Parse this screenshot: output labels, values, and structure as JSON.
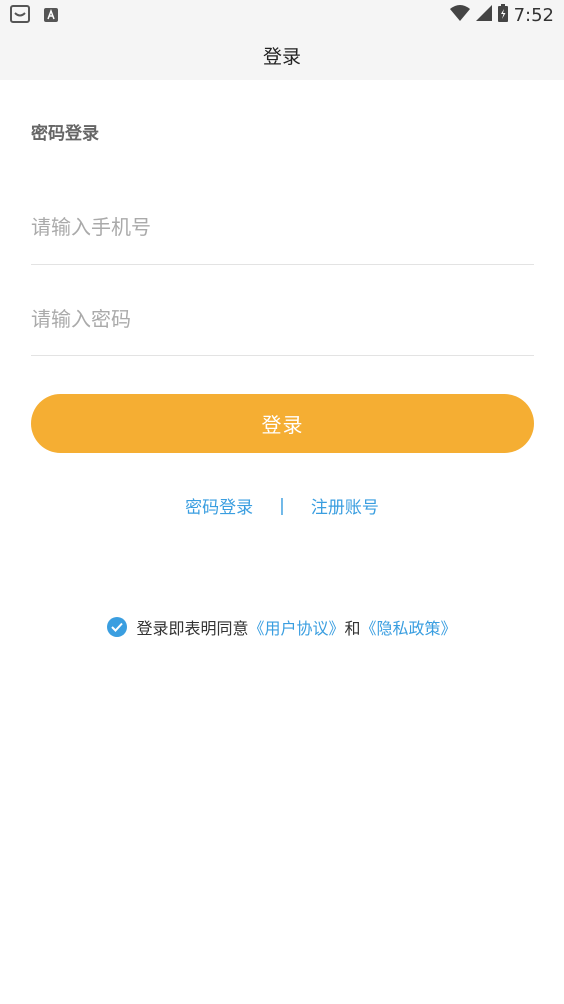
{
  "statusbar": {
    "time": "7:52",
    "icons": [
      "notification-icon",
      "a-icon",
      "wifi-icon",
      "signal-icon",
      "battery-icon"
    ]
  },
  "header": {
    "title": "登录"
  },
  "form": {
    "section_title": "密码登录",
    "phone_placeholder": "请输入手机号",
    "password_placeholder": "请输入密码",
    "login_button": "登录"
  },
  "links": {
    "password_login": "密码登录",
    "separator": "|",
    "register": "注册账号"
  },
  "agreement": {
    "prefix": "登录即表明同意",
    "user_agreement": "《用户协议》",
    "and": "和",
    "privacy_policy": "《隐私政策》",
    "checked": true
  },
  "colors": {
    "accent": "#f5ae33",
    "link": "#3a9ee0",
    "header_bg": "#f5f5f5"
  }
}
